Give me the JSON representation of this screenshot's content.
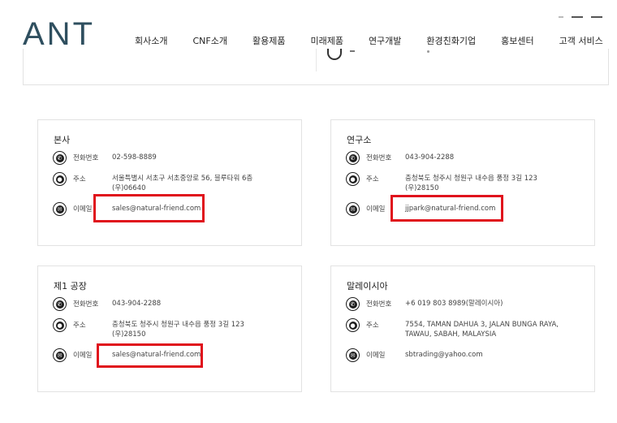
{
  "header": {
    "logo": "ANT",
    "nav": [
      "회사소개",
      "CNF소개",
      "활용제품",
      "미래제품",
      "연구개발",
      "환경친화기업",
      "홍보센터",
      "고객 서비스"
    ]
  },
  "offices": [
    {
      "title": "본사",
      "phone_label": "전화번호",
      "phone": "02-598-8889",
      "address_label": "주소",
      "address_line1": "서울특별시 서초구 서초중앙로 56, 블루타워 6층",
      "address_line2": "(우)06640",
      "email_label": "이메일",
      "email": "sales@natural-friend.com"
    },
    {
      "title": "연구소",
      "phone_label": "전화번호",
      "phone": "043-904-2288",
      "address_label": "주소",
      "address_line1": "충청북도 청주시 청원구 내수읍 풍정 3길 123",
      "address_line2": "(우)28150",
      "email_label": "이메일",
      "email": "jjpark@natural-friend.com"
    },
    {
      "title": "제1 공장",
      "phone_label": "전화번호",
      "phone": "043-904-2288",
      "address_label": "주소",
      "address_line1": "충청북도 청주시 청원구 내수읍 풍정 3길 123",
      "address_line2": "(우)28150",
      "email_label": "이메일",
      "email": "sales@natural-friend.com"
    },
    {
      "title": "말레이시아",
      "phone_label": "전화번호",
      "phone": "+6 019 803 8989(말레이시아)",
      "address_label": "주소",
      "address_line1": "7554, TAMAN DAHUA 3, JALAN BUNGA RAYA,",
      "address_line2": "TAWAU, SABAH, MALAYSIA",
      "email_label": "이메일",
      "email": "sbtrading@yahoo.com"
    }
  ],
  "colors": {
    "highlight": "#e0121c",
    "logo": "#2f4f5f"
  }
}
